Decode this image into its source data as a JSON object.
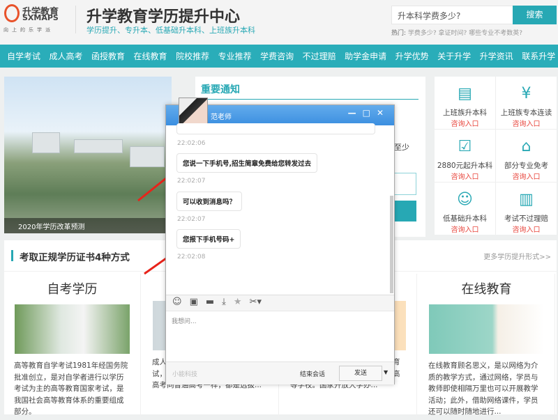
{
  "header": {
    "logo_cn": "升学教育",
    "logo_en": "SXMAPS",
    "logo_slogan": "向上的乐学派",
    "title": "升学教育学历提升中心",
    "subtitle": "学历提升、专升本、低基础升本科、上班族升本科",
    "search_value": "升本科学费多少?",
    "search_button": "搜索",
    "hot_label": "热门:",
    "hot_links": "学费多少? 拿证时间? 哪些专业不考数英?"
  },
  "nav": [
    "自学考试",
    "成人高考",
    "函授教育",
    "在线教育",
    "院校推荐",
    "专业推荐",
    "学费咨询",
    "不过理赔",
    "助学金申请",
    "升学优势",
    "关于升学",
    "升学资讯",
    "联系升学"
  ],
  "banner": {
    "caption": "2020年学历改革预测"
  },
  "notice": {
    "title": "重要通知",
    "text": "至少"
  },
  "services": [
    {
      "label": "上班族升本科",
      "sub": "咨询入口",
      "icon": "document-icon"
    },
    {
      "label": "上班族专本连读",
      "sub": "咨询入口",
      "icon": "yen-icon"
    },
    {
      "label": "2880元起升本科",
      "sub": "咨询入口",
      "icon": "checklist-clock-icon"
    },
    {
      "label": "部分专业免考",
      "sub": "咨询入口",
      "icon": "house-icon"
    },
    {
      "label": "低基础升本科",
      "sub": "咨询入口",
      "icon": "user-edit-icon"
    },
    {
      "label": "考试不过理赔",
      "sub": "咨询入口",
      "icon": "binders-icon"
    }
  ],
  "section": {
    "title": "考取正规学历证书4种方式",
    "more": "更多学历提升形式>>",
    "cards": [
      {
        "title": "自考学历",
        "text": "高等教育自学考试1981年经国务院批准创立，是对自学者进行以学历考试为主的高等教育国家考试，是我国社会高等教育体系的重要组成部分。"
      },
      {
        "title": "",
        "text": "成人…拔合…学历教育的入学考试，属于国民教育系列教育。成人高考同普通高考一样，都是选拔..."
      },
      {
        "title": "",
        "text": "…部…择。学历教育与非学历教育并举。实施远程开放教育的新型高等学校。国家开放大学办..."
      },
      {
        "title": "在线教育",
        "text": "在线教育顾名思义，是以网络为介质的教学方式，通过网络，学员与教师即使相隔万里也可以开展教学活动；此外，借助网络课件，学员还可以随时随地进行..."
      }
    ]
  },
  "chat": {
    "name": "范老师",
    "messages": [
      {
        "time": "22:02:06",
        "text": "您说一下手机号,招生简章免费给您转发过去"
      },
      {
        "time": "22:02:07",
        "text": "可以收到消息吗？"
      },
      {
        "time": "22:02:07",
        "text": "您报下手机号码+"
      }
    ],
    "last_time": "22:02:08",
    "placeholder": "我想问...",
    "brand": "小能科技",
    "end": "结束会话",
    "send": "发送"
  },
  "colors": {
    "accent": "#2aadb9",
    "chat_blue": "#3b8fe0",
    "alert": "#e8453c"
  }
}
